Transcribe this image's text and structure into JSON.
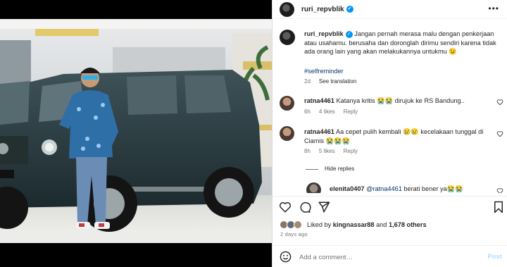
{
  "post": {
    "author": "ruri_repvblik",
    "caption": "Jangan pernah merasa malu dengan penkerjaan atau usahamu. berusaha dan doronglah dirimu sendiri karena tidak ada orang lain yang akan melakukannya untukmu 😉",
    "hashtag": "#selfreminder",
    "time": "2d",
    "see_translation": "See translation"
  },
  "comments": [
    {
      "user": "ratna4461",
      "text": "Katanya kritis 😭😭 dirujuk ke RS Bandung..",
      "time": "6h",
      "likes": "4 likes",
      "reply": "Reply"
    },
    {
      "user": "ratna4461",
      "text": "Aa cepet pulih kembali 😢😢 kecelakaan tunggal di Ciamis 😭😭😭",
      "time": "8h",
      "likes": "5 likes",
      "reply": "Reply"
    }
  ],
  "hide_replies": "Hide replies",
  "reply_comment": {
    "user": "elenita0407",
    "mention": "@ratna4461",
    "text": " berati bener ya😭😭"
  },
  "liked_by": {
    "prefix": "Liked by ",
    "user": "kingnassar88",
    "middle": " and ",
    "count": "1,678 others"
  },
  "posted_ago": "2 days ago",
  "add_comment": {
    "placeholder": "Add a comment…",
    "post_label": "Post"
  },
  "icons": [
    "heart-icon",
    "comment-icon",
    "share-icon",
    "bookmark-icon",
    "emoji-icon",
    "more-icon",
    "verified-icon"
  ],
  "colors": {
    "link": "#00376b",
    "verified": "#0095f6",
    "post_disabled": "#b3dbff",
    "muted": "#737373"
  }
}
